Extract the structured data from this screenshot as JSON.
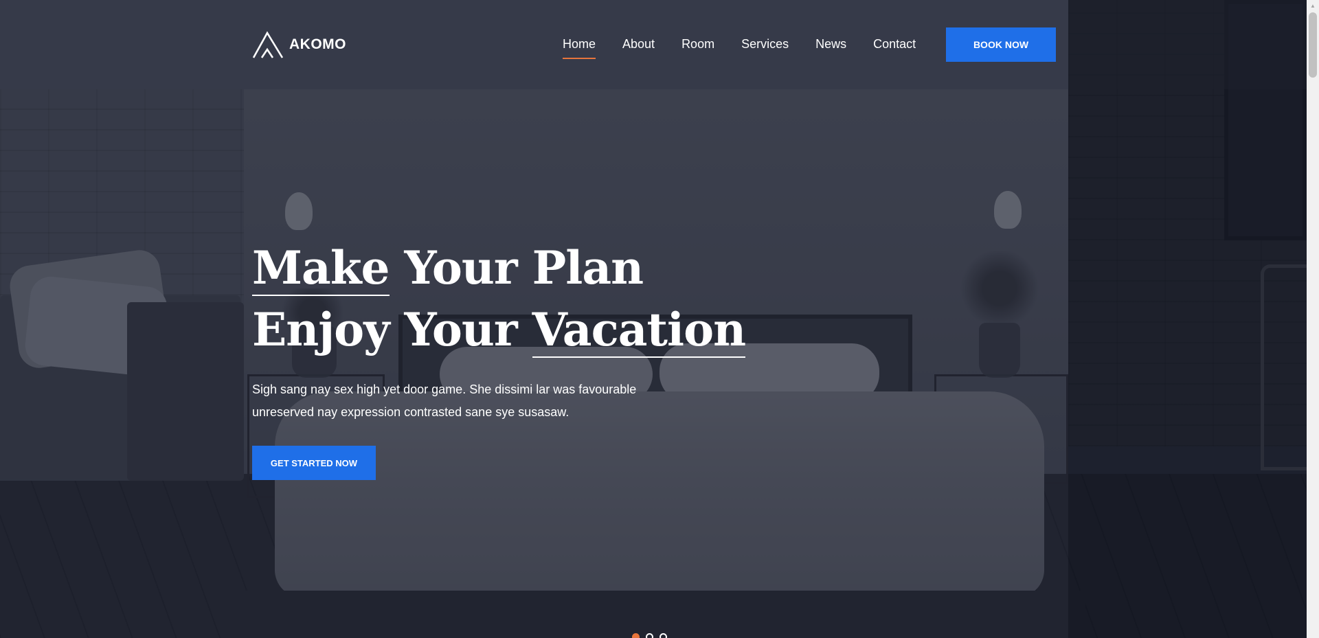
{
  "brand": {
    "logo_icon": "mountain-logo-icon",
    "name": "AKOMO"
  },
  "nav": {
    "items": [
      {
        "label": "Home",
        "active": true
      },
      {
        "label": "About",
        "active": false
      },
      {
        "label": "Room",
        "active": false
      },
      {
        "label": "Services",
        "active": false
      },
      {
        "label": "News",
        "active": false
      },
      {
        "label": "Contact",
        "active": false
      }
    ],
    "book_label": "BOOK NOW"
  },
  "hero": {
    "title_line1_word1": "Make",
    "title_line1_rest": " Your Plan",
    "title_line2_start": "Enjoy Your ",
    "title_line2_word": "Vacation",
    "description": "Sigh sang nay sex high yet door game. She dissimi lar was favourable unreserved nay expression contrasted sane sye susasaw.",
    "cta_label": "GET STARTED NOW",
    "slider": {
      "count": 3,
      "active_index": 0
    }
  },
  "colors": {
    "accent": "#e8753c",
    "button": "#1f6fe8",
    "header": "#363a49"
  }
}
